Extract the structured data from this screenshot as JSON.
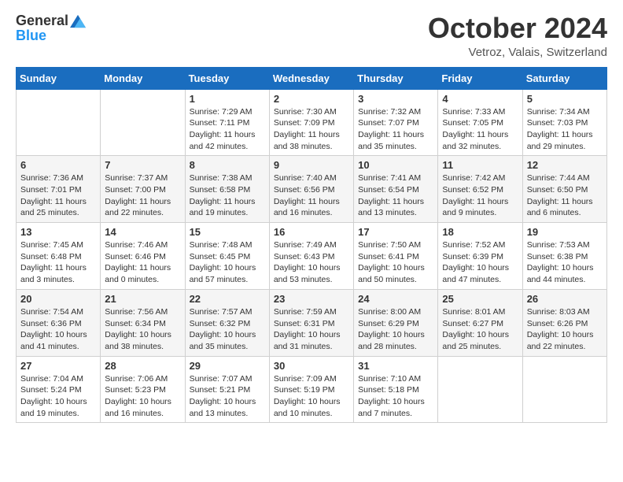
{
  "logo": {
    "general": "General",
    "blue": "Blue"
  },
  "title": "October 2024",
  "location": "Vetroz, Valais, Switzerland",
  "weekdays": [
    "Sunday",
    "Monday",
    "Tuesday",
    "Wednesday",
    "Thursday",
    "Friday",
    "Saturday"
  ],
  "weeks": [
    [
      {
        "day": "",
        "sunrise": "",
        "sunset": "",
        "daylight": ""
      },
      {
        "day": "",
        "sunrise": "",
        "sunset": "",
        "daylight": ""
      },
      {
        "day": "1",
        "sunrise": "Sunrise: 7:29 AM",
        "sunset": "Sunset: 7:11 PM",
        "daylight": "Daylight: 11 hours and 42 minutes."
      },
      {
        "day": "2",
        "sunrise": "Sunrise: 7:30 AM",
        "sunset": "Sunset: 7:09 PM",
        "daylight": "Daylight: 11 hours and 38 minutes."
      },
      {
        "day": "3",
        "sunrise": "Sunrise: 7:32 AM",
        "sunset": "Sunset: 7:07 PM",
        "daylight": "Daylight: 11 hours and 35 minutes."
      },
      {
        "day": "4",
        "sunrise": "Sunrise: 7:33 AM",
        "sunset": "Sunset: 7:05 PM",
        "daylight": "Daylight: 11 hours and 32 minutes."
      },
      {
        "day": "5",
        "sunrise": "Sunrise: 7:34 AM",
        "sunset": "Sunset: 7:03 PM",
        "daylight": "Daylight: 11 hours and 29 minutes."
      }
    ],
    [
      {
        "day": "6",
        "sunrise": "Sunrise: 7:36 AM",
        "sunset": "Sunset: 7:01 PM",
        "daylight": "Daylight: 11 hours and 25 minutes."
      },
      {
        "day": "7",
        "sunrise": "Sunrise: 7:37 AM",
        "sunset": "Sunset: 7:00 PM",
        "daylight": "Daylight: 11 hours and 22 minutes."
      },
      {
        "day": "8",
        "sunrise": "Sunrise: 7:38 AM",
        "sunset": "Sunset: 6:58 PM",
        "daylight": "Daylight: 11 hours and 19 minutes."
      },
      {
        "day": "9",
        "sunrise": "Sunrise: 7:40 AM",
        "sunset": "Sunset: 6:56 PM",
        "daylight": "Daylight: 11 hours and 16 minutes."
      },
      {
        "day": "10",
        "sunrise": "Sunrise: 7:41 AM",
        "sunset": "Sunset: 6:54 PM",
        "daylight": "Daylight: 11 hours and 13 minutes."
      },
      {
        "day": "11",
        "sunrise": "Sunrise: 7:42 AM",
        "sunset": "Sunset: 6:52 PM",
        "daylight": "Daylight: 11 hours and 9 minutes."
      },
      {
        "day": "12",
        "sunrise": "Sunrise: 7:44 AM",
        "sunset": "Sunset: 6:50 PM",
        "daylight": "Daylight: 11 hours and 6 minutes."
      }
    ],
    [
      {
        "day": "13",
        "sunrise": "Sunrise: 7:45 AM",
        "sunset": "Sunset: 6:48 PM",
        "daylight": "Daylight: 11 hours and 3 minutes."
      },
      {
        "day": "14",
        "sunrise": "Sunrise: 7:46 AM",
        "sunset": "Sunset: 6:46 PM",
        "daylight": "Daylight: 11 hours and 0 minutes."
      },
      {
        "day": "15",
        "sunrise": "Sunrise: 7:48 AM",
        "sunset": "Sunset: 6:45 PM",
        "daylight": "Daylight: 10 hours and 57 minutes."
      },
      {
        "day": "16",
        "sunrise": "Sunrise: 7:49 AM",
        "sunset": "Sunset: 6:43 PM",
        "daylight": "Daylight: 10 hours and 53 minutes."
      },
      {
        "day": "17",
        "sunrise": "Sunrise: 7:50 AM",
        "sunset": "Sunset: 6:41 PM",
        "daylight": "Daylight: 10 hours and 50 minutes."
      },
      {
        "day": "18",
        "sunrise": "Sunrise: 7:52 AM",
        "sunset": "Sunset: 6:39 PM",
        "daylight": "Daylight: 10 hours and 47 minutes."
      },
      {
        "day": "19",
        "sunrise": "Sunrise: 7:53 AM",
        "sunset": "Sunset: 6:38 PM",
        "daylight": "Daylight: 10 hours and 44 minutes."
      }
    ],
    [
      {
        "day": "20",
        "sunrise": "Sunrise: 7:54 AM",
        "sunset": "Sunset: 6:36 PM",
        "daylight": "Daylight: 10 hours and 41 minutes."
      },
      {
        "day": "21",
        "sunrise": "Sunrise: 7:56 AM",
        "sunset": "Sunset: 6:34 PM",
        "daylight": "Daylight: 10 hours and 38 minutes."
      },
      {
        "day": "22",
        "sunrise": "Sunrise: 7:57 AM",
        "sunset": "Sunset: 6:32 PM",
        "daylight": "Daylight: 10 hours and 35 minutes."
      },
      {
        "day": "23",
        "sunrise": "Sunrise: 7:59 AM",
        "sunset": "Sunset: 6:31 PM",
        "daylight": "Daylight: 10 hours and 31 minutes."
      },
      {
        "day": "24",
        "sunrise": "Sunrise: 8:00 AM",
        "sunset": "Sunset: 6:29 PM",
        "daylight": "Daylight: 10 hours and 28 minutes."
      },
      {
        "day": "25",
        "sunrise": "Sunrise: 8:01 AM",
        "sunset": "Sunset: 6:27 PM",
        "daylight": "Daylight: 10 hours and 25 minutes."
      },
      {
        "day": "26",
        "sunrise": "Sunrise: 8:03 AM",
        "sunset": "Sunset: 6:26 PM",
        "daylight": "Daylight: 10 hours and 22 minutes."
      }
    ],
    [
      {
        "day": "27",
        "sunrise": "Sunrise: 7:04 AM",
        "sunset": "Sunset: 5:24 PM",
        "daylight": "Daylight: 10 hours and 19 minutes."
      },
      {
        "day": "28",
        "sunrise": "Sunrise: 7:06 AM",
        "sunset": "Sunset: 5:23 PM",
        "daylight": "Daylight: 10 hours and 16 minutes."
      },
      {
        "day": "29",
        "sunrise": "Sunrise: 7:07 AM",
        "sunset": "Sunset: 5:21 PM",
        "daylight": "Daylight: 10 hours and 13 minutes."
      },
      {
        "day": "30",
        "sunrise": "Sunrise: 7:09 AM",
        "sunset": "Sunset: 5:19 PM",
        "daylight": "Daylight: 10 hours and 10 minutes."
      },
      {
        "day": "31",
        "sunrise": "Sunrise: 7:10 AM",
        "sunset": "Sunset: 5:18 PM",
        "daylight": "Daylight: 10 hours and 7 minutes."
      },
      {
        "day": "",
        "sunrise": "",
        "sunset": "",
        "daylight": ""
      },
      {
        "day": "",
        "sunrise": "",
        "sunset": "",
        "daylight": ""
      }
    ]
  ]
}
